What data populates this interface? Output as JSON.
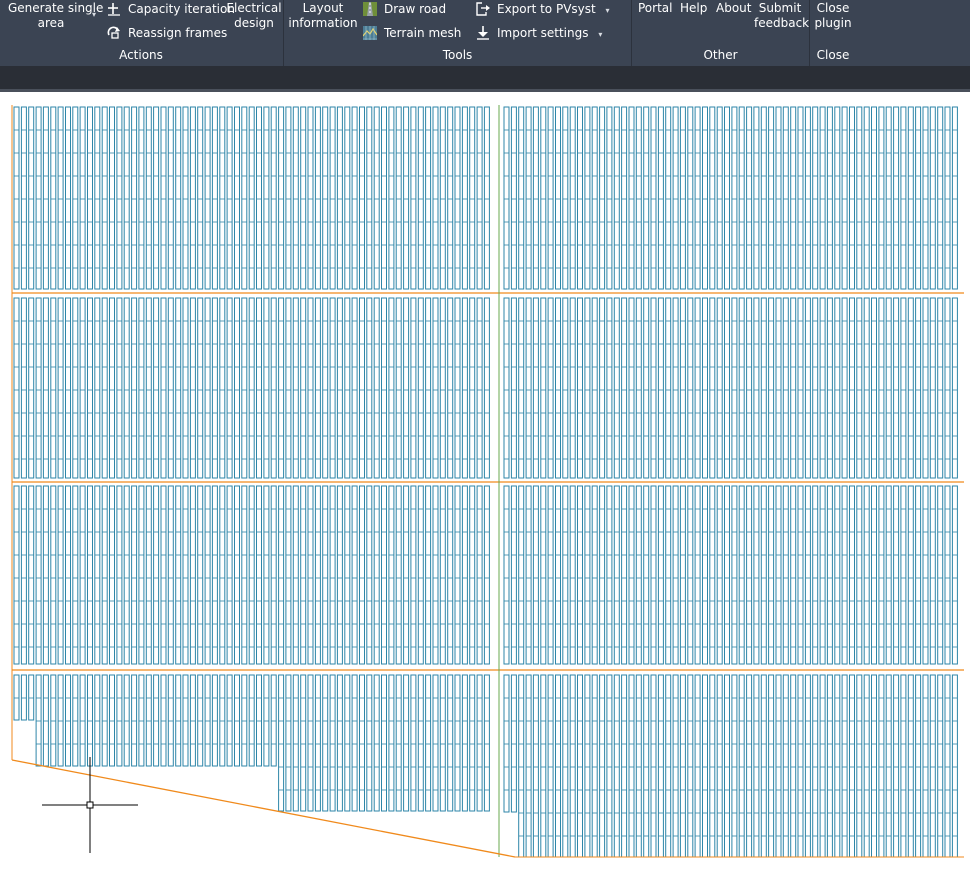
{
  "ribbon": {
    "actions": {
      "generate_single_area": "Generate single area",
      "generate_single_area_line1": "Generate single",
      "generate_single_area_line2": "area",
      "capacity_iteration": "Capacity iteration",
      "reassign_frames": "Reassign frames",
      "electrical_design_line1": "Electrical",
      "electrical_design_line2": "design",
      "group_label": "Actions"
    },
    "tools": {
      "layout_information_line1": "Layout",
      "layout_information_line2": "information",
      "draw_road": "Draw road",
      "terrain_mesh": "Terrain mesh",
      "export_to_pvsyst": "Export to PVsyst",
      "import_settings": "Import settings",
      "group_label": "Tools"
    },
    "other": {
      "portal": "Portal",
      "help": "Help",
      "about": "About",
      "submit_feedback_line1": "Submit",
      "submit_feedback_line2": "feedback",
      "group_label": "Other"
    },
    "close": {
      "close_plugin_line1": "Close",
      "close_plugin_line2": "plugin",
      "group_label": "Close"
    }
  },
  "icons": {
    "capacity_iteration": "plus-icon",
    "reassign_frames": "reassign-icon",
    "draw_road": "road-icon",
    "terrain_mesh": "mesh-icon",
    "export_to_pvsyst": "export-icon",
    "import_settings": "download-icon",
    "dropdown": "caret-down-icon"
  },
  "colors": {
    "ribbon_bg": "#3b4453",
    "tabbar_bg": "#2a2e36",
    "canvas_bg": "#ffffff",
    "panel_table": "#2e86a8",
    "boundary": "#f08a1c",
    "divider_green": "#6aa84f",
    "cursor": "#000000"
  }
}
